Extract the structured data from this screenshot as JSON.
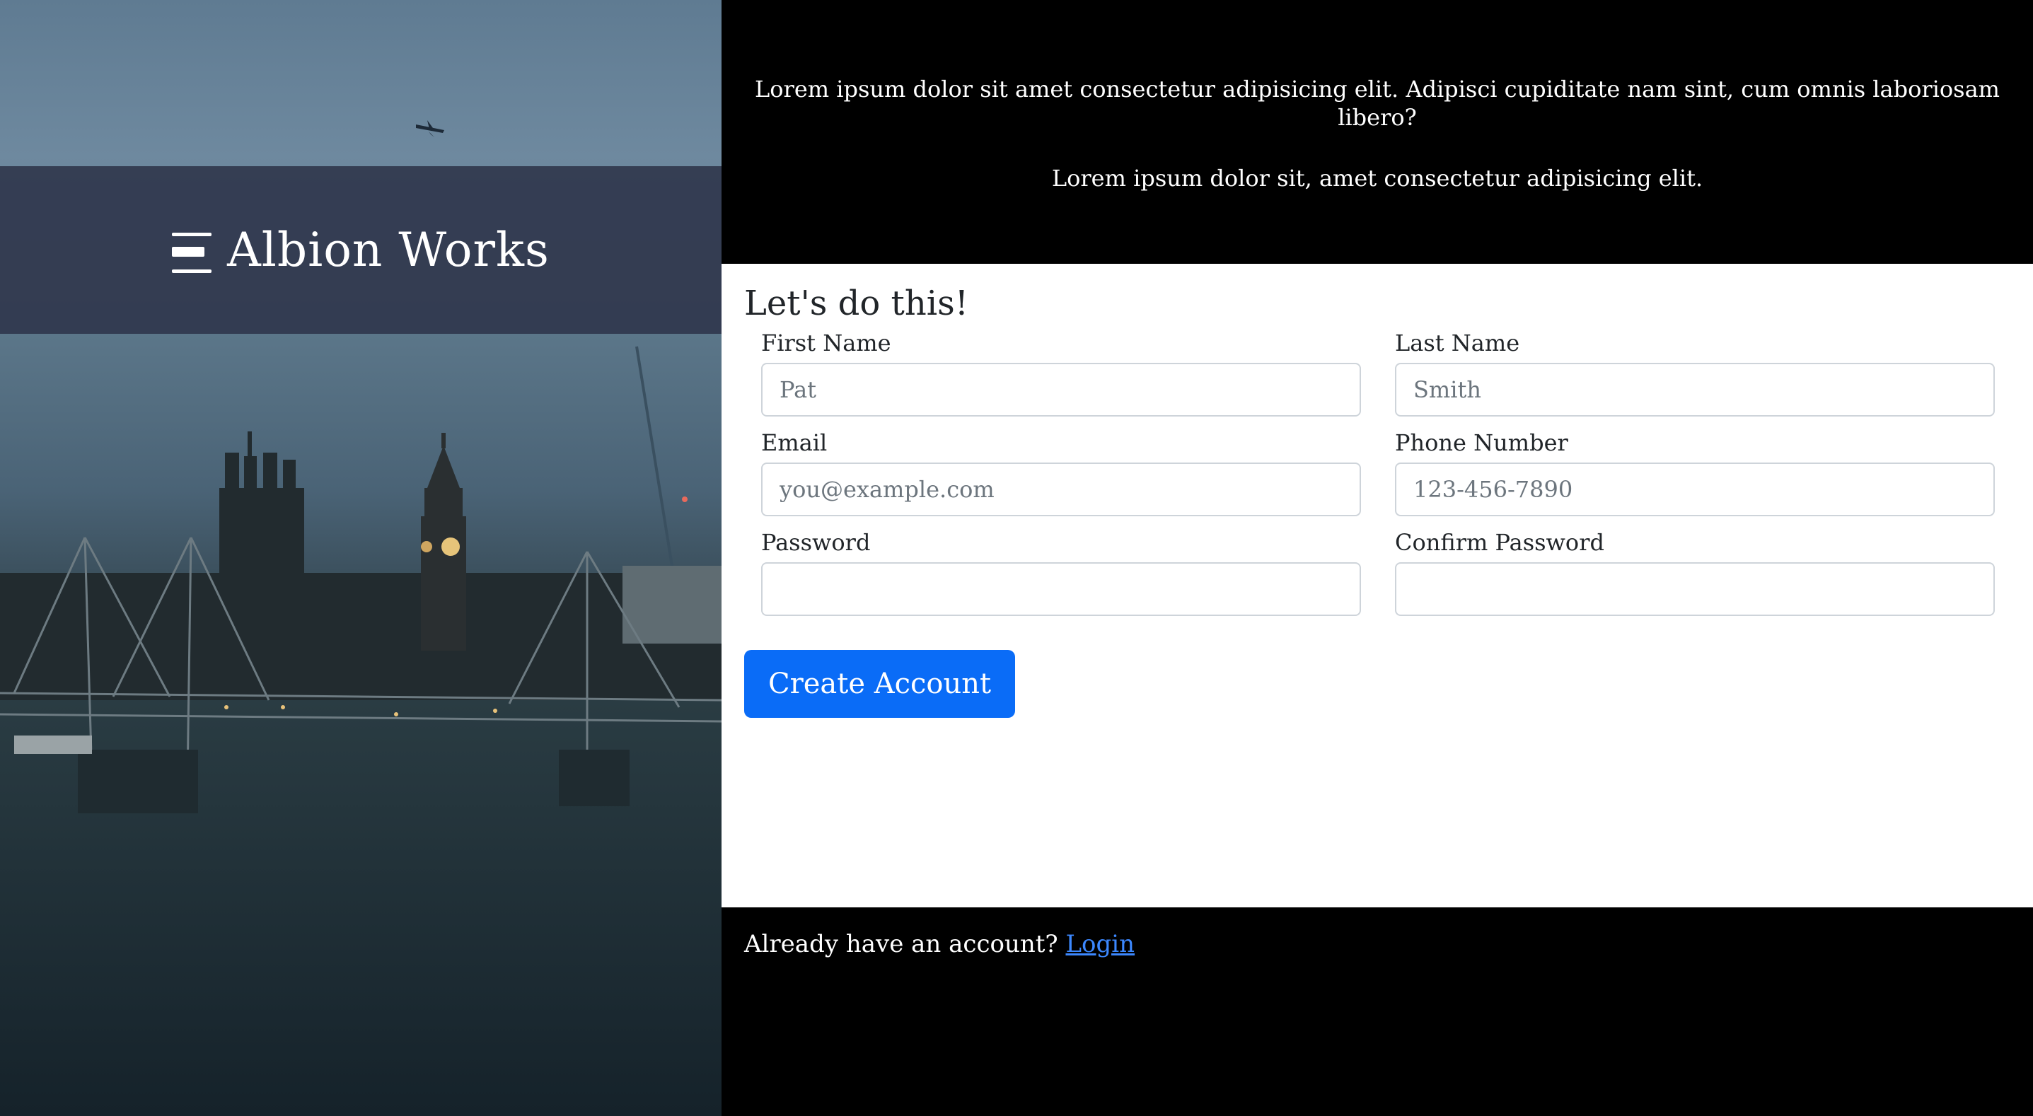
{
  "brand": {
    "name": "Albion Works",
    "icon": "menu-bars-icon"
  },
  "background_image": {
    "description_icon": "london-skyline-photo"
  },
  "intro": {
    "line1": "Lorem ipsum dolor sit amet consectetur adipisicing elit. Adipisci cupiditate nam sint, cum omnis laboriosam libero?",
    "line2": "Lorem ipsum dolor sit, amet consectetur adipisicing elit."
  },
  "form": {
    "title": "Let's do this!",
    "first_name": {
      "label": "First Name",
      "placeholder": "Pat"
    },
    "last_name": {
      "label": "Last Name",
      "placeholder": "Smith"
    },
    "email": {
      "label": "Email",
      "placeholder": "you@example.com"
    },
    "phone": {
      "label": "Phone Number",
      "placeholder": "123-456-7890"
    },
    "password": {
      "label": "Password",
      "placeholder": ""
    },
    "confirm_password": {
      "label": "Confirm Password",
      "placeholder": ""
    },
    "submit_label": "Create Account"
  },
  "footer": {
    "prompt": "Already have an account?",
    "login_label": "Login"
  },
  "colors": {
    "accent": "#0a6cf7",
    "link": "#3c88ff",
    "band": "#30384e"
  }
}
